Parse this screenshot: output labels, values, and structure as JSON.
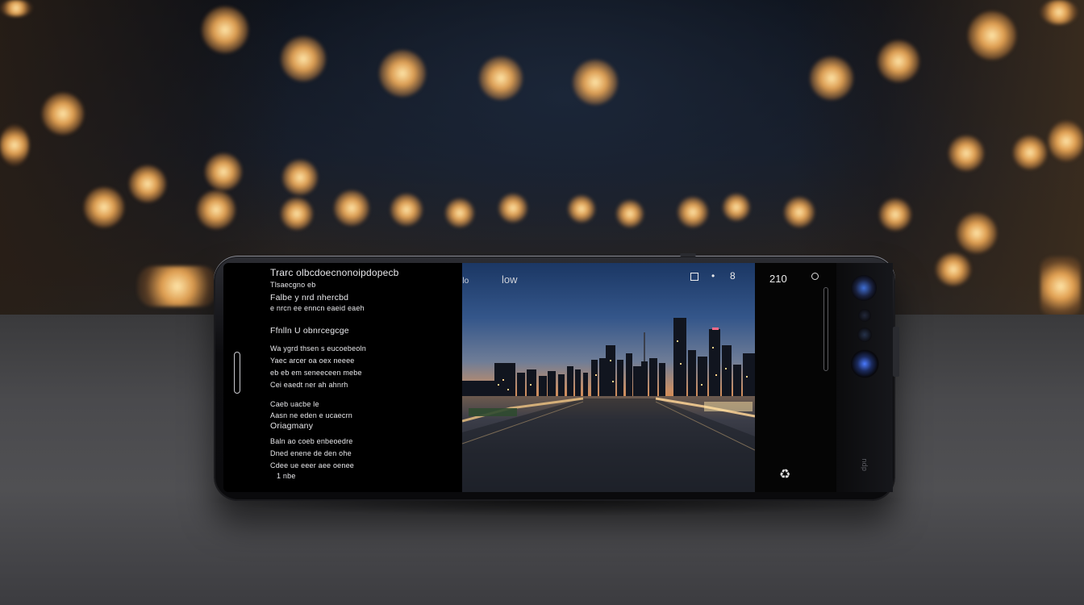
{
  "screen_left_text": {
    "lines": [
      "Trarc olbcdoecnonoipdopecb",
      "Tlsaecgno eb",
      "Falbe y nrd nhercbd",
      "e nrcn ee enncn eaeid eaeh",
      "Ffnlln U obnrcegcge",
      "Wa ygrd thsen s eucoebeoln",
      "Yaec arcer oa oex neeee",
      "eb eb em seneeceen mebe",
      "Cei eaedt ner ah ahnrh",
      "Caeb uacbe le",
      "Aasn ne eden e ucaecrn",
      "Oriagmany",
      "Baln ao coeb enbeoedre",
      "Dned enene de den ohe",
      "Cdee ue eeer aee oenee",
      "1 nbe"
    ]
  },
  "photo_overlay": {
    "left_label": "lnu ilo",
    "center_label": "low",
    "hud_icon": "square-icon",
    "dot": "•",
    "hud_value": "8"
  },
  "right_panel": {
    "counter": "210",
    "top_icon": "target-icon",
    "bottom_icon": "recycle-icon",
    "side_label": "dpu"
  },
  "colors": {
    "screen_background": "#000000",
    "bokeh": "#ffc27a",
    "phone_frame": "#0c0c0f"
  }
}
